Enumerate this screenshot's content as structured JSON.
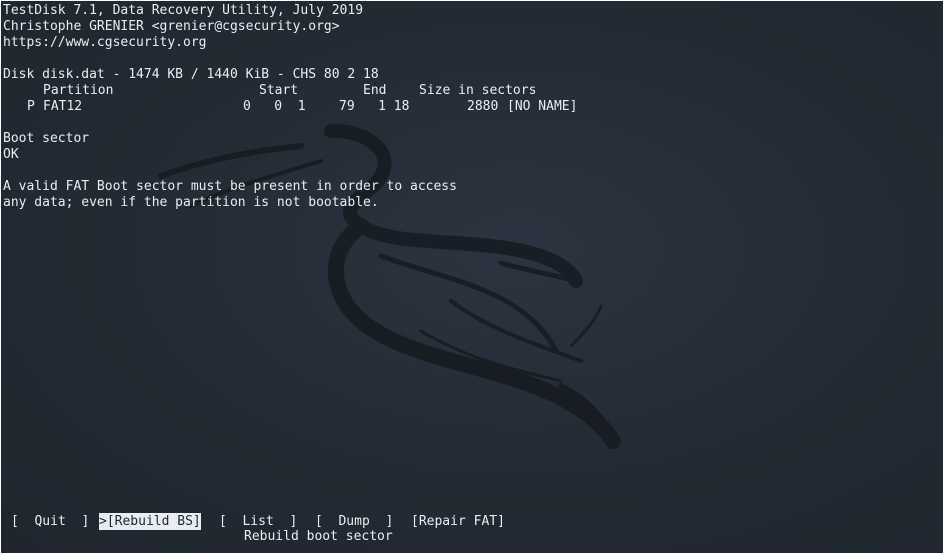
{
  "header": {
    "title_line": "TestDisk 7.1, Data Recovery Utility, July 2019",
    "author_line": "Christophe GRENIER <grenier@cgsecurity.org>",
    "url_line": "https://www.cgsecurity.org"
  },
  "disk": {
    "info": "Disk disk.dat - 1474 KB / 1440 KiB - CHS 80 2 18"
  },
  "partition_table": {
    "headers": {
      "partition": "Partition",
      "start": "Start",
      "end": "End",
      "size": "Size in sectors"
    },
    "rows": [
      {
        "flag": "P",
        "type": "FAT12",
        "start": "0   0  1",
        "end": "79   1 18",
        "size": "2880",
        "name": "[NO NAME]"
      }
    ]
  },
  "boot_sector": {
    "label": "Boot sector",
    "status": "OK"
  },
  "message": {
    "line1": "A valid FAT Boot sector must be present in order to access",
    "line2": "any data; even if the partition is not bootable."
  },
  "menu": {
    "items": [
      "[  Quit  ]",
      ">[Rebuild BS]",
      "[  List  ]",
      "[  Dump  ]",
      "[Repair FAT]"
    ],
    "selected_index": 1,
    "help_text": "Rebuild boot sector"
  },
  "colors": {
    "background": "#232a33",
    "foreground": "#e9eef2",
    "dragon": "#161b21"
  },
  "icons": {
    "background_logo": "kali-dragon-icon"
  }
}
